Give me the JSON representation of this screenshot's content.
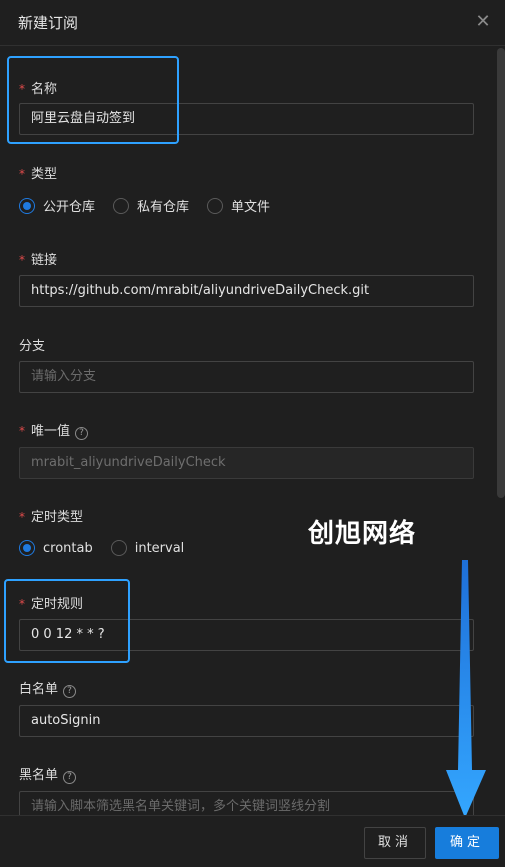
{
  "modal": {
    "title": "新建订阅",
    "close_icon": "close-icon"
  },
  "fields": {
    "name": {
      "label": "名称",
      "required": true,
      "value": "阿里云盘自动签到"
    },
    "type": {
      "label": "类型",
      "required": true,
      "options": [
        "公开仓库",
        "私有仓库",
        "单文件"
      ],
      "selected": "公开仓库"
    },
    "link": {
      "label": "链接",
      "required": true,
      "value": "https://github.com/mrabit/aliyundriveDailyCheck.git"
    },
    "branch": {
      "label": "分支",
      "required": false,
      "placeholder": "请输入分支"
    },
    "unique": {
      "label": "唯一值",
      "required": true,
      "value": "mrabit_aliyundriveDailyCheck"
    },
    "schedule_type": {
      "label": "定时类型",
      "required": true,
      "options": [
        "crontab",
        "interval"
      ],
      "selected": "crontab"
    },
    "schedule": {
      "label": "定时规则",
      "required": true,
      "value": "0 0 12 * * ?"
    },
    "whitelist": {
      "label": "白名单",
      "required": false,
      "value": "autoSignin"
    },
    "blacklist": {
      "label": "黑名单",
      "required": false,
      "placeholder": "请输入脚本筛选黑名单关键词，多个关键词竖线分割"
    }
  },
  "watermark": "创旭网络",
  "footer": {
    "cancel_label": "取消",
    "ok_label": "确定"
  },
  "colors": {
    "primary": "#177ddc",
    "highlight": "#2ea1ff",
    "required": "#e04b4b",
    "background": "#1f1f1f"
  }
}
